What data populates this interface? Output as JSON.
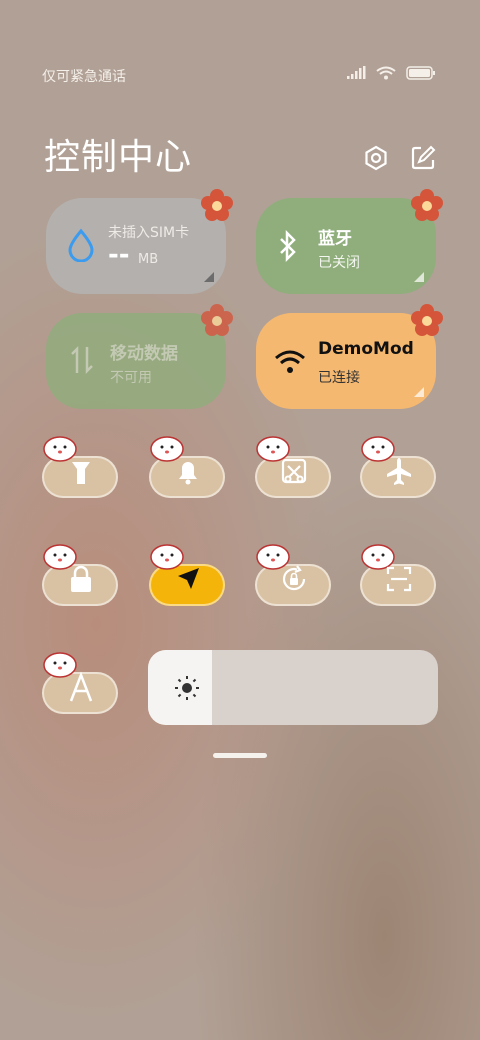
{
  "status": {
    "text": "仅可紧急通话"
  },
  "title": "控制中心",
  "cards": {
    "sim": {
      "label": "未插入SIM卡",
      "value": "--",
      "unit": "MB"
    },
    "bluetooth": {
      "label": "蓝牙",
      "status": "已关闭"
    },
    "mobile_data": {
      "label": "移动数据",
      "status": "不可用"
    },
    "wifi": {
      "label": "DemoMod",
      "status": "已连接"
    }
  },
  "tiles": [
    {
      "name": "flashlight-icon"
    },
    {
      "name": "bell-icon"
    },
    {
      "name": "screenshot-icon"
    },
    {
      "name": "airplane-icon"
    },
    {
      "name": "lock-icon"
    },
    {
      "name": "location-icon"
    },
    {
      "name": "rotation-lock-icon"
    },
    {
      "name": "scan-icon"
    },
    {
      "name": "font-icon"
    }
  ],
  "brightness": {
    "level": 0.22
  },
  "colors": {
    "accent_orange": "#f5b871",
    "green": "#8fae7c",
    "grey": "#b3b0ad",
    "flower": "#d4553a"
  }
}
